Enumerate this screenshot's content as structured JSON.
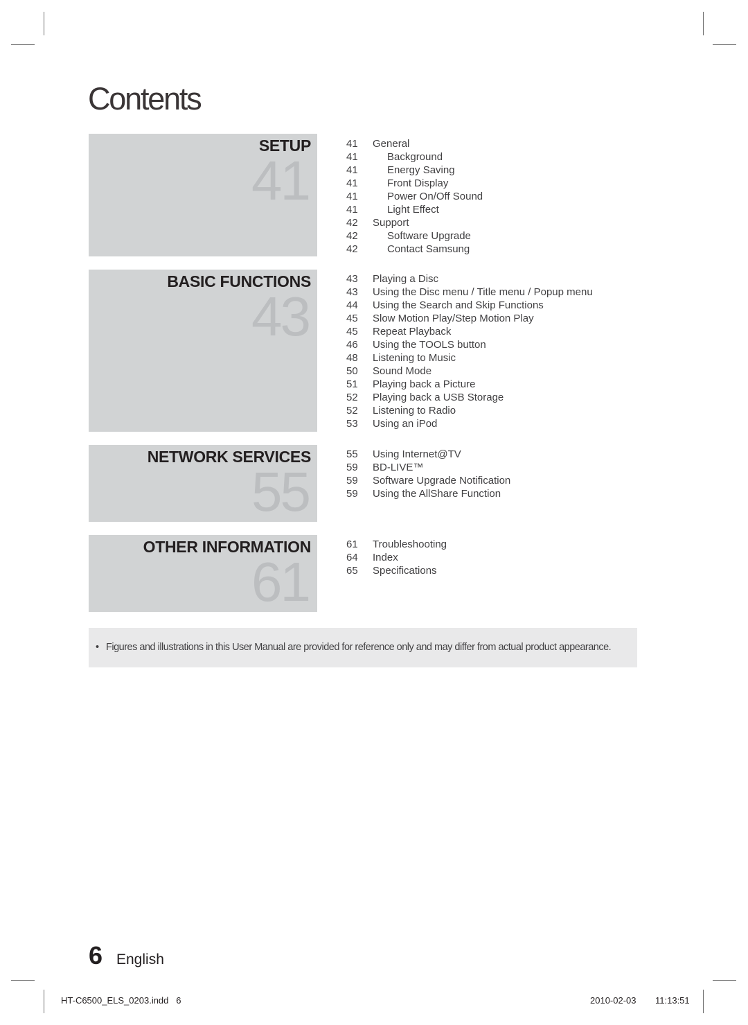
{
  "page": {
    "title": "Contents"
  },
  "sections": [
    {
      "title": "SETUP",
      "start_page": "41",
      "entries": [
        {
          "page": "41",
          "label": "General",
          "level": 1
        },
        {
          "page": "41",
          "label": "Background",
          "level": 2
        },
        {
          "page": "41",
          "label": "Energy Saving",
          "level": 2
        },
        {
          "page": "41",
          "label": "Front Display",
          "level": 2
        },
        {
          "page": "41",
          "label": "Power On/Off Sound",
          "level": 2
        },
        {
          "page": "41",
          "label": "Light Effect",
          "level": 2
        },
        {
          "page": "42",
          "label": "Support",
          "level": 1
        },
        {
          "page": "42",
          "label": "Software Upgrade",
          "level": 2
        },
        {
          "page": "42",
          "label": "Contact Samsung",
          "level": 2
        }
      ]
    },
    {
      "title": "BASIC FUNCTIONS",
      "start_page": "43",
      "entries": [
        {
          "page": "43",
          "label": "Playing a Disc",
          "level": 1
        },
        {
          "page": "43",
          "label": "Using the Disc menu / Title menu / Popup menu",
          "level": 1
        },
        {
          "page": "44",
          "label": "Using the Search and Skip Functions",
          "level": 1
        },
        {
          "page": "45",
          "label": "Slow Motion Play/Step Motion Play",
          "level": 1
        },
        {
          "page": "45",
          "label": "Repeat Playback",
          "level": 1
        },
        {
          "page": "46",
          "label": "Using the TOOLS button",
          "level": 1
        },
        {
          "page": "48",
          "label": "Listening to Music",
          "level": 1
        },
        {
          "page": "50",
          "label": "Sound Mode",
          "level": 1
        },
        {
          "page": "51",
          "label": "Playing back a Picture",
          "level": 1
        },
        {
          "page": "52",
          "label": "Playing back a USB Storage",
          "level": 1
        },
        {
          "page": "52",
          "label": "Listening to Radio",
          "level": 1
        },
        {
          "page": "53",
          "label": "Using an iPod",
          "level": 1
        }
      ]
    },
    {
      "title": "NETWORK SERVICES",
      "start_page": "55",
      "entries": [
        {
          "page": "55",
          "label": "Using Internet@TV",
          "level": 1
        },
        {
          "page": "59",
          "label": "BD-LIVE™",
          "level": 1
        },
        {
          "page": "59",
          "label": "Software Upgrade Notification",
          "level": 1
        },
        {
          "page": "59",
          "label": "Using the AllShare Function",
          "level": 1
        }
      ]
    },
    {
      "title": "OTHER INFORMATION",
      "start_page": "61",
      "entries": [
        {
          "page": "61",
          "label": "Troubleshooting",
          "level": 1
        },
        {
          "page": "64",
          "label": "Index",
          "level": 1
        },
        {
          "page": "65",
          "label": "Specifications",
          "level": 1
        }
      ]
    }
  ],
  "note": {
    "bullet": "•",
    "text": "Figures and illustrations in this User Manual are provided for reference only and may differ from actual product appearance."
  },
  "footer": {
    "page_number": "6",
    "language": "English",
    "slug_file": "HT-C6500_ELS_0203.indd   6",
    "slug_date": "2010-02-03",
    "slug_time": "11:13:51"
  }
}
